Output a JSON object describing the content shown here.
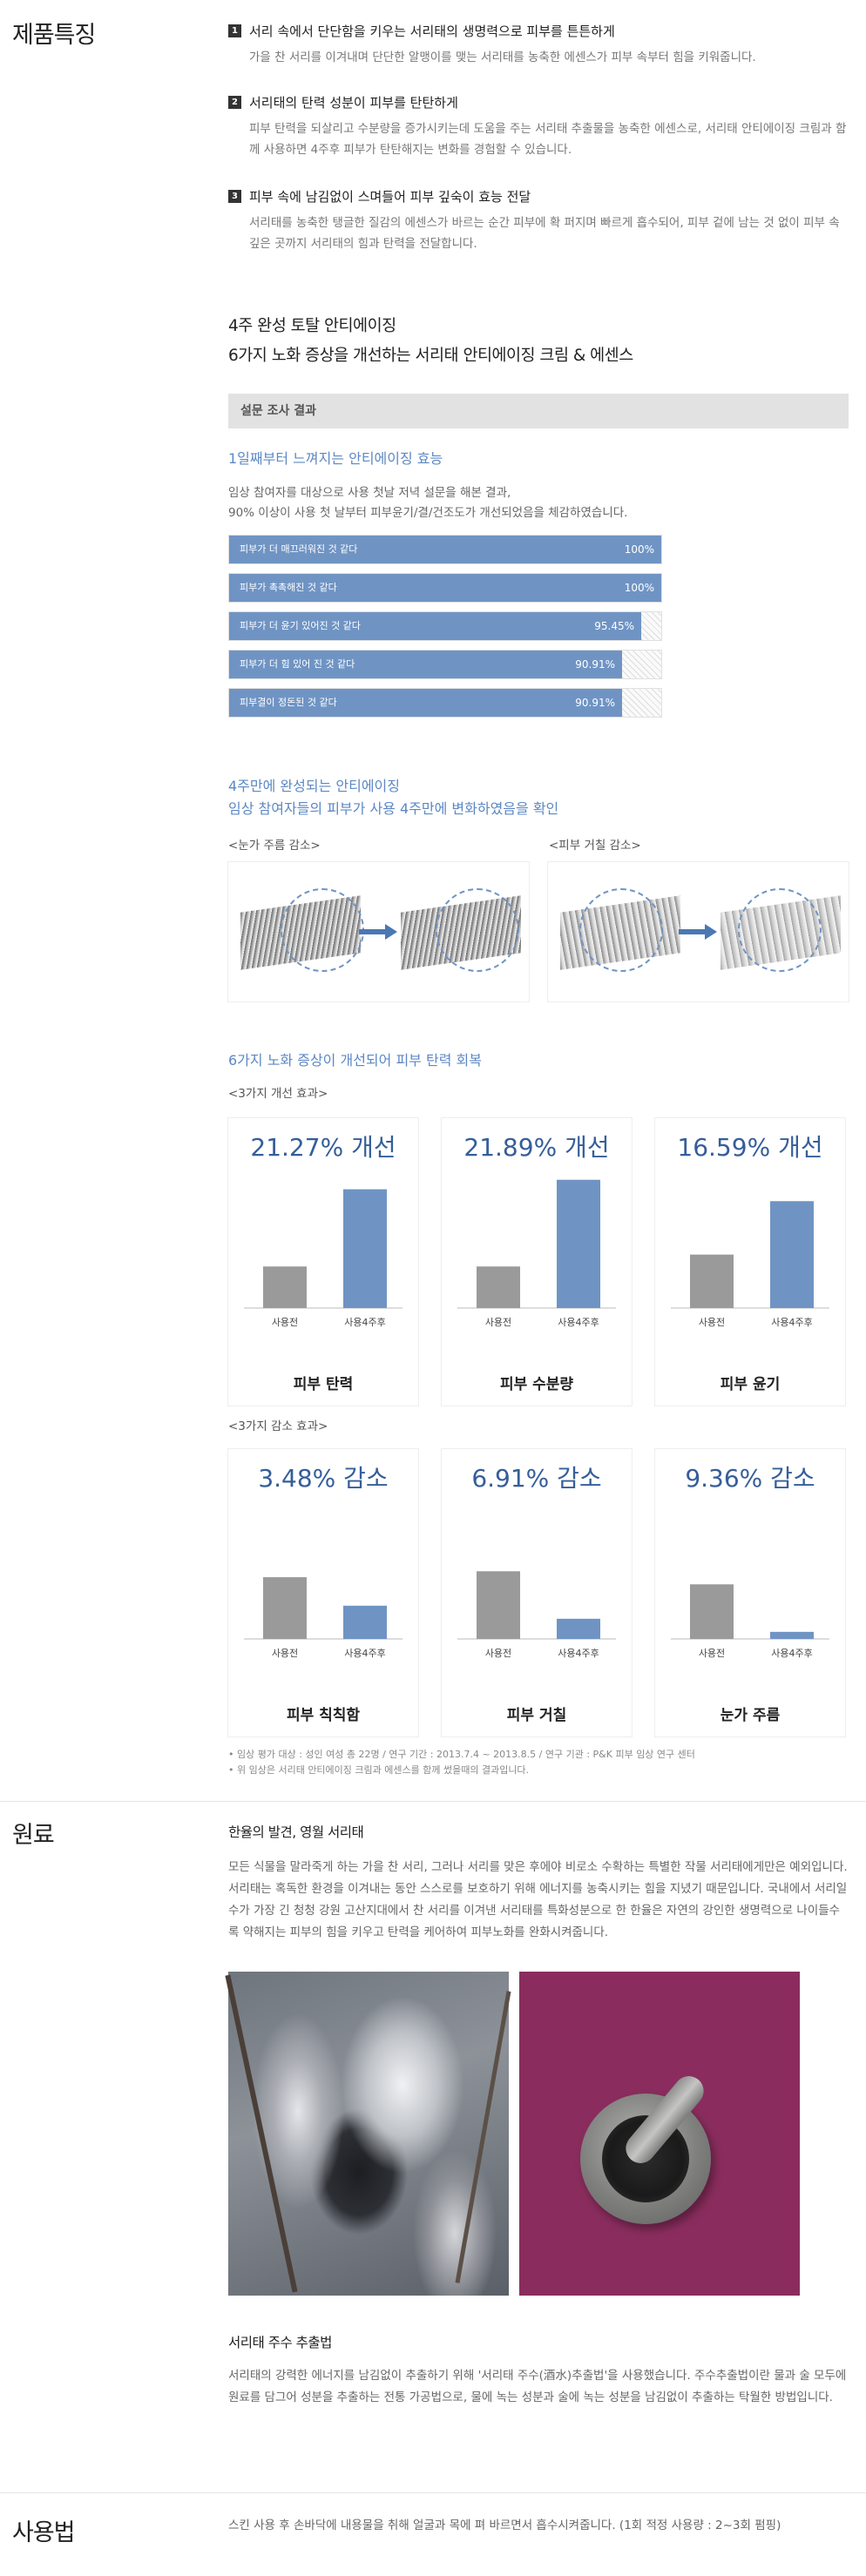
{
  "sections": {
    "features": "제품특징",
    "ingredients": "원료",
    "usage": "사용법"
  },
  "features": [
    {
      "num": "1",
      "title": "서리 속에서 단단함을 키우는 서리태의 생명력으로 피부를 튼튼하게",
      "desc": "가을 찬 서리를 이겨내며 단단한 알맹이를 맺는 서리태를 농축한 에센스가 피부 속부터 힘을 키워줍니다."
    },
    {
      "num": "2",
      "title": "서리태의 탄력 성분이 피부를 탄탄하게",
      "desc": "피부 탄력을 되살리고 수분량을 증가시키는데 도움을 주는 서리태 추출물을 농축한 에센스로, 서리태 안티에이징 크림과 함께 사용하면 4주후 피부가 탄탄해지는 변화를 경험할 수 있습니다."
    },
    {
      "num": "3",
      "title": "피부 속에 남김없이 스며들어 피부 깊숙이 효능 전달",
      "desc": "서리태를 농축한 탱글한 질감의 에센스가 바르는 순간 피부에 확 퍼지며 빠르게 흡수되어, 피부 겉에 남는 것 없이 피부 속 깊은 곳까지 서리태의 힘과 탄력을 전달합니다."
    }
  ],
  "headline": {
    "line1": "4주 완성 토탈 안티에이징",
    "line2": "6가지 노화 증상을 개선하는 서리태 안티에이징 크림 & 에센스"
  },
  "survey": {
    "label": "설문 조사 결과",
    "title": "1일째부터 느껴지는 안티에이징 효능",
    "desc1": "임상 참여자를 대상으로 사용 첫날 저녁 설문을 해본 결과,",
    "desc2": "90% 이상이 사용 첫 날부터 피부윤기/결/건조도가 개선되었음을 체감하였습니다.",
    "bars": [
      {
        "label": "피부가 더 매끄러워진 것 같다",
        "value": 100,
        "text": "100%"
      },
      {
        "label": "피부가 촉촉해진 것 같다",
        "value": 100,
        "text": "100%"
      },
      {
        "label": "피부가 더 윤기 있어진 것 같다",
        "value": 95.45,
        "text": "95.45%"
      },
      {
        "label": "피부가 더 힘 있어 진 것 같다",
        "value": 90.91,
        "text": "90.91%"
      },
      {
        "label": "피부결이 정돈된 것 같다",
        "value": 90.91,
        "text": "90.91%"
      }
    ]
  },
  "fourweek": {
    "title1": "4주만에 완성되는 안티에이징",
    "title2": "임상 참여자들의 피부가 사용 4주만에 변화하였음을 확인",
    "eye_label": "<눈가 주름 감소>",
    "rough_label": "<피부 거칠 감소>"
  },
  "improve": {
    "title": "6가지 노화 증상이 개선되어 피부 탄력 회복",
    "group1_label": "<3가지 개선 효과>",
    "group2_label": "<3가지 감소 효과>",
    "before_label": "사용전",
    "after_label": "사용4주후"
  },
  "chart_data": [
    {
      "type": "bar",
      "title": "21.27% 개선",
      "categories": [
        "사용전",
        "사용4주후"
      ],
      "values": [
        0.35,
        1.0
      ],
      "xlabel": "피부 탄력"
    },
    {
      "type": "bar",
      "title": "21.89% 개선",
      "categories": [
        "사용전",
        "사용4주후"
      ],
      "values": [
        0.35,
        1.08
      ],
      "xlabel": "피부 수분량"
    },
    {
      "type": "bar",
      "title": "16.59% 개선",
      "categories": [
        "사용전",
        "사용4주후"
      ],
      "values": [
        0.45,
        0.9
      ],
      "xlabel": "피부 윤기"
    },
    {
      "type": "bar",
      "title": "3.48% 감소",
      "categories": [
        "사용전",
        "사용4주후"
      ],
      "values": [
        0.52,
        0.28
      ],
      "xlabel": "피부 칙칙함"
    },
    {
      "type": "bar",
      "title": "6.91% 감소",
      "categories": [
        "사용전",
        "사용4주후"
      ],
      "values": [
        0.57,
        0.17
      ],
      "xlabel": "피부 거칠"
    },
    {
      "type": "bar",
      "title": "9.36% 감소",
      "categories": [
        "사용전",
        "사용4주후"
      ],
      "values": [
        0.46,
        0.06
      ],
      "xlabel": "눈가 주름"
    }
  ],
  "notes": [
    "• 임상 평가 대상 : 성인 여성 총 22명 / 연구 기간 : 2013.7.4 ~ 2013.8.5 / 연구 기관 : P&K 피부 임상 연구 센터",
    "• 위 임상은 서리태 안티에이징 크림과 에센스를 함께 썼을때의 결과입니다."
  ],
  "ingredient": {
    "title": "한율의 발견, 영월 서리태",
    "desc": "모든 식물을 말라죽게 하는 가을 찬 서리, 그러나 서리를 맞은 후에야 비로소 수확하는 특별한 작물 서리태에게만은 예외입니다. 서리태는 혹독한 환경을 이겨내는 동안 스스로를 보호하기 위해 에너지를 농축시키는 힘을 지녔기 때문입니다. 국내에서 서리일수가 가장 긴 청청 강원 고산지대에서 찬 서리를 이겨낸 서리태를 특화성분으로 한 한율은 자연의 강인한 생명력으로 나이들수록 약해지는 피부의 힘을 키우고 탄력을 케어하여 피부노화를 완화시켜줍니다.",
    "method_title": "서리태 주수 추출법",
    "method_desc": "서리태의 강력한 에너지를 남김없이 추출하기 위해 '서리태 주수(酒水)추출법'을 사용했습니다. 주수추출법이란 물과 술 모두에 원료를 담그어 성분을 추출하는 전통 가공법으로, 물에 녹는 성분과 술에 녹는 성분을 남김없이 추출하는 탁월한 방법입니다."
  },
  "usage": {
    "desc": "스킨 사용 후 손바닥에 내용물을 취해 얼굴과 목에 펴 바르면서 흡수시켜줍니다. (1회 적정 사용량 : 2~3회 펌핑)"
  },
  "colors": {
    "accent": "#5c88c5",
    "bar": "#6f94c4",
    "before": "#9a9a9a",
    "title_blue": "#355e9a",
    "plum": "#8a2d5e"
  }
}
